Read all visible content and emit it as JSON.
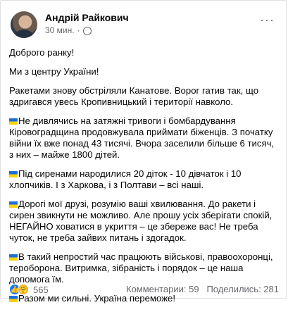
{
  "post": {
    "author": "Андрій Райкович",
    "time": "30 мин.",
    "more_label": "···",
    "paragraphs": [
      "Доброго ранку!",
      "Ми з центру України!",
      "Ракетами знову обстріляли Канатове. Ворог гатив так, що здригався увесь Кропивницький і території навколо.",
      "Не дивлячись на затяжні тривоги і бомбардування Кіровоградщина продовжувала приймати біженців. З початку війни їх вже понад 43 тисячі. Вчора заселили більше 6 тисяч, з них – майже 1800 дітей.",
      "Під сиренами народилися 20 діток - 10 дівчаток і 10 хлопчиків. І з Харкова, і з Полтави – всі наші.",
      "Дорогі мої друзі, розумію ваші хвилювання. До ракети і сирен звикнути не можливо. Але прошу усіх зберігати спокій, НЕГАЙНО ховатися в укриття – це збереже вас! Не треба чуток, не треба зайвих питань і здогадок.",
      "В такий непростий час працюють військові, правоохоронці, тероборона. Витримка, зібраність і порядок – це наша допомога їм.",
      "Разом ми сильні. Україна переможе!"
    ],
    "flag_icon": "ukraine-flag-icon"
  },
  "footer": {
    "reaction_count": "565",
    "comments": "Комментарии: 59",
    "shares": "Поделились: 281"
  },
  "colors": {
    "link_blue": "#1877f2",
    "secondary_text": "#65676b",
    "flag_blue": "#1e6ed8",
    "flag_yellow": "#f5d20c"
  }
}
